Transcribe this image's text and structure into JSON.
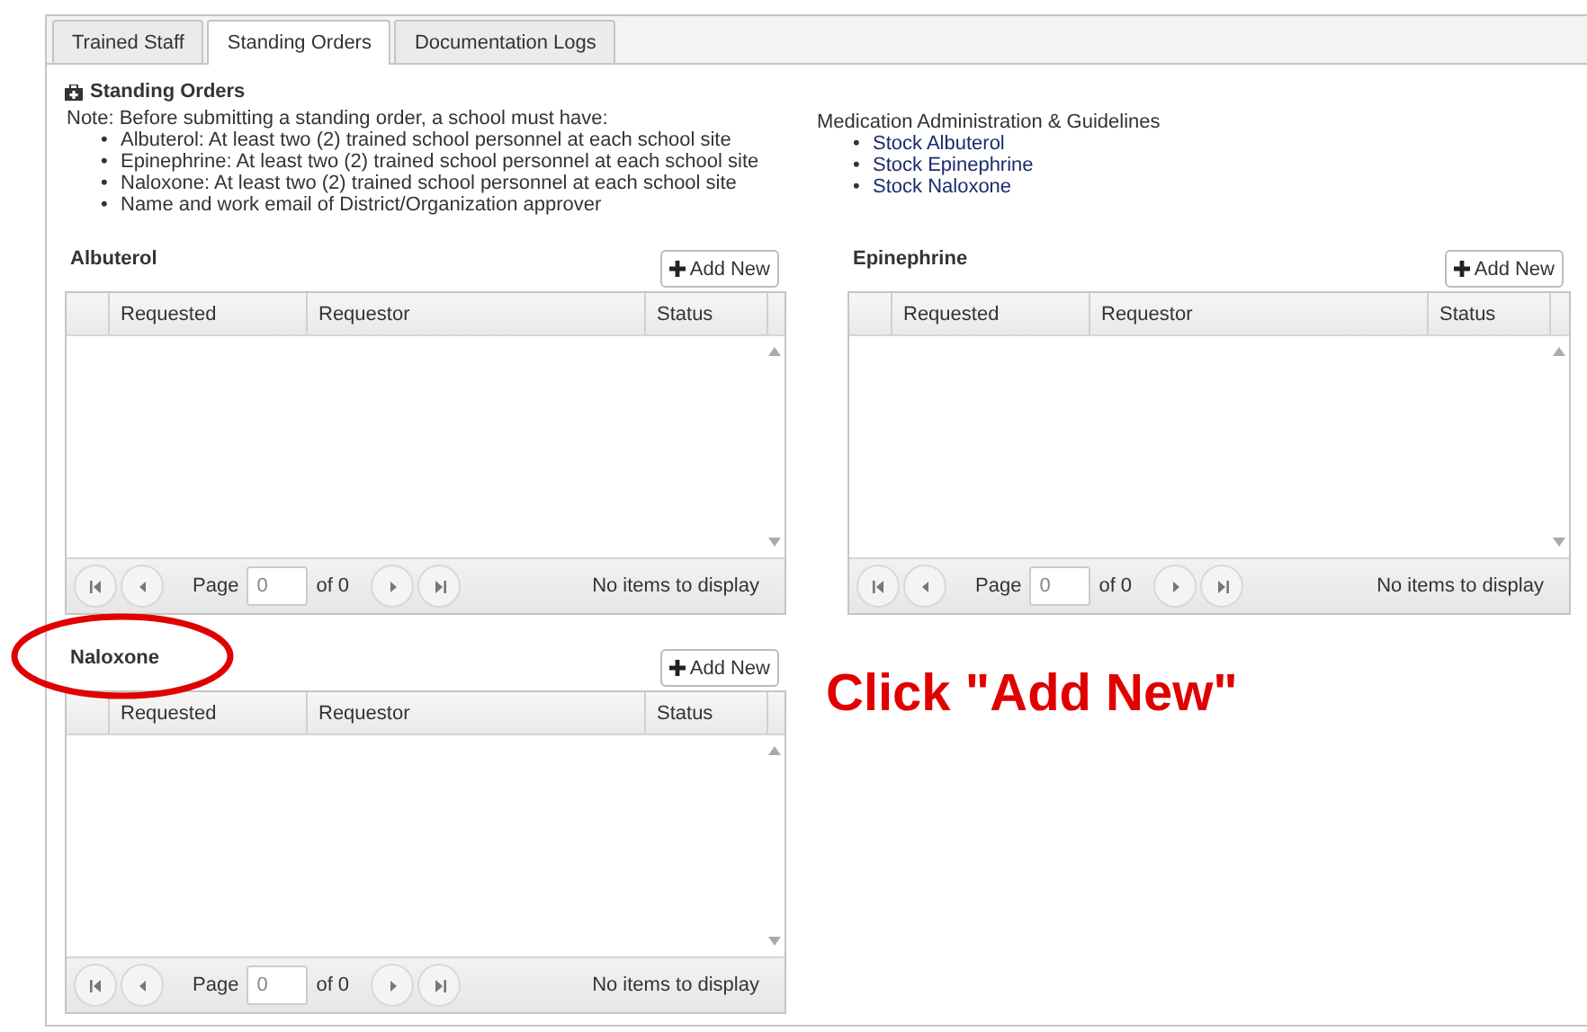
{
  "tabs": [
    {
      "label": "Trained Staff",
      "selected": false
    },
    {
      "label": "Standing Orders",
      "selected": true
    },
    {
      "label": "Documentation Logs",
      "selected": false
    }
  ],
  "section": {
    "title": "Standing Orders",
    "note": "Note: Before submitting a standing order, a school must have:",
    "requirements": [
      {
        "bullet": "•",
        "text": "Albuterol: At least two (2) trained school personnel at each school site"
      },
      {
        "bullet": "•",
        "text": "Epinephrine: At least two (2) trained school personnel at each school site"
      },
      {
        "bullet": "•",
        "text": "Naloxone: At least two (2) trained school personnel at each school site"
      },
      {
        "bullet": "•",
        "text": "Name and work email of District/Organization approver"
      }
    ],
    "guidelines_title": "Medication Administration & Guidelines",
    "guidelines": [
      {
        "bullet": "•",
        "text": "Stock Albuterol"
      },
      {
        "bullet": "•",
        "text": "Stock Epinephrine"
      },
      {
        "bullet": "•",
        "text": "Stock Naloxone"
      }
    ]
  },
  "panels": [
    {
      "title": "Albuterol",
      "highlighted": false,
      "button": "Add New",
      "columns": [
        "Requested",
        "Requestor",
        "Status"
      ],
      "pager": {
        "page_label": "Page",
        "page_value": "0",
        "of_label": "of 0",
        "status": "No items to display"
      }
    },
    {
      "title": "Epinephrine",
      "highlighted": false,
      "button": "Add New",
      "columns": [
        "Requested",
        "Requestor",
        "Status"
      ],
      "pager": {
        "page_label": "Page",
        "page_value": "0",
        "of_label": "of 0",
        "status": "No items to display"
      }
    },
    {
      "title": "Naloxone",
      "highlighted": true,
      "button": "Add New",
      "columns": [
        "Requested",
        "Requestor",
        "Status"
      ],
      "pager": {
        "page_label": "Page",
        "page_value": "0",
        "of_label": "of 0",
        "status": "No items to display"
      }
    }
  ],
  "annotation": {
    "text": "Click \"Add New\""
  }
}
